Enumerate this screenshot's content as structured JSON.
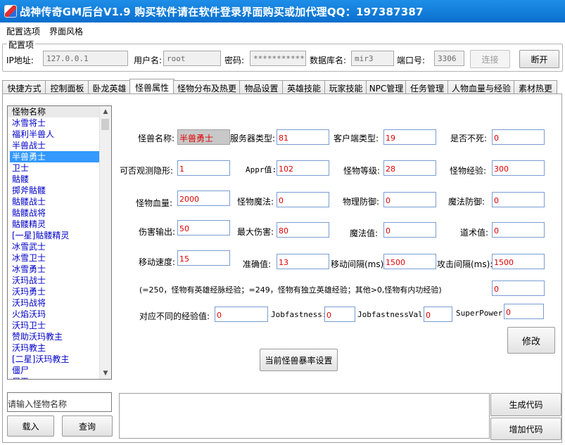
{
  "window": {
    "title": "战神传奇GM后台V1.9   购买软件请在软件登录界面购买或加代理QQ：197387387"
  },
  "menu": {
    "items": [
      "配置选项",
      "界面风格"
    ]
  },
  "config": {
    "group_title": "配置项",
    "ip_label": "IP地址:",
    "ip_value": "127.0.0.1",
    "user_label": "用户名:",
    "user_value": "root",
    "pwd_label": "密码:",
    "pwd_value": "************",
    "db_label": "数据库名:",
    "db_value": "mir3",
    "port_label": "端口号:",
    "port_value": "3306",
    "connect_label": "连接",
    "disconnect_label": "断开"
  },
  "tabs": [
    "快捷方式",
    "控制面板",
    "卧龙英雄",
    "怪兽属性",
    "怪物分布及热更",
    "物品设置",
    "英雄技能",
    "玩家技能",
    "NPC管理",
    "任务管理",
    "人物血量与经验",
    "素材热更"
  ],
  "active_tab": "怪兽属性",
  "monster_list": {
    "header": "怪物名称",
    "items": [
      "冰雪将士",
      "福利半兽人",
      "半兽战士",
      "半兽勇士",
      "卫士",
      "骷髅",
      "掷斧骷髅",
      "骷髅战士",
      "骷髅战将",
      "骷髅精灵",
      "[一星]骷髅精灵",
      "冰雪武士",
      "冰雪卫士",
      "冰雪勇士",
      "沃玛战士",
      "沃玛勇士",
      "沃玛战将",
      "火焰沃玛",
      "沃玛卫士",
      "赞助沃玛教主",
      "沃玛教主",
      "[二星]沃玛教主",
      "僵尸",
      "尸王"
    ],
    "selected": "半兽勇士",
    "search_placeholder": "请输入怪物名称",
    "load_label": "载入",
    "query_label": "查询"
  },
  "form": {
    "name_label": "怪兽名称:",
    "name_value": "半兽勇士",
    "server_type_label": "服务器类型:",
    "server_type_value": "81",
    "client_type_label": "客户端类型:",
    "client_type_value": "19",
    "undead_label": "是否不死:",
    "undead_value": "0",
    "stealth_label": "可否观测隐形:",
    "stealth_value": "1",
    "appr_label": "Appr值:",
    "appr_value": "102",
    "level_label": "怪物等级:",
    "level_value": "28",
    "exp_label": "怪物经验:",
    "exp_value": "300",
    "hp_label": "怪物血量:",
    "hp_value": "2000",
    "mp_label": "怪物魔法:",
    "mp_value": "0",
    "pdef_label": "物理防御:",
    "pdef_value": "0",
    "mdef_label": "魔法防御:",
    "mdef_value": "0",
    "dmg_label": "伤害输出:",
    "dmg_value": "50",
    "maxdmg_label": "最大伤害:",
    "maxdmg_value": "80",
    "magic_label": "魔法值:",
    "magic_value": "0",
    "tao_label": "道术值:",
    "tao_value": "0",
    "speed_label": "移动速度:",
    "speed_value": "15",
    "accuracy_label": "准确值:",
    "accuracy_value": "13",
    "move_interval_label": "移动间隔(ms):",
    "move_interval_value": "1500",
    "attack_interval_label": "攻击间隔(ms):",
    "attack_interval_value": "1500",
    "note": "(=250，怪物有英雄经脉经验；=249，怪物有独立英雄经验；其他>0,怪物有内功经验)",
    "note_value": "0",
    "diff_exp_label": "对应不同的经验值:",
    "diff_exp_value": "0",
    "jobfast_label": "Jobfastness:",
    "jobfast_value": "0",
    "jobfastval_label": "JobfastnessVal:",
    "jobfastval_value": "0",
    "superpower_label": "SuperPower:",
    "superpower_value": "0",
    "modify_label": "修改",
    "drop_label": "当前怪兽暴率设置",
    "gen_code_label": "生成代码",
    "add_code_label": "增加代码"
  }
}
